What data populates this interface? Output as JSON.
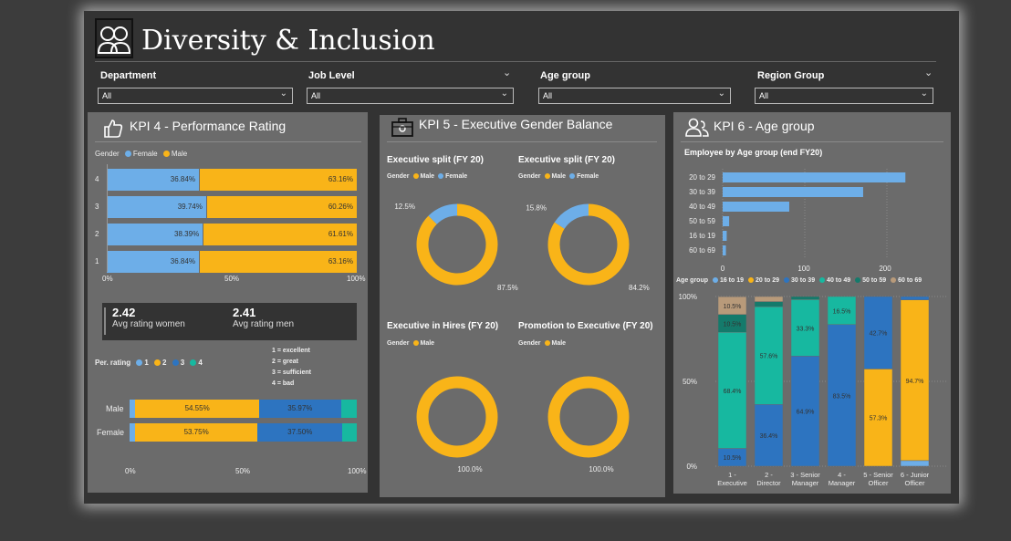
{
  "page": {
    "title": "Diversity & Inclusion"
  },
  "colors": {
    "female": "#6daee8",
    "male": "#f9b418",
    "rating1": "#6daee8",
    "rating2": "#f9b418",
    "rating3": "#2d74c0",
    "rating4": "#17b8a0",
    "age16_19": "#6daee8",
    "age20_29": "#f9b418",
    "age30_39": "#2d74c0",
    "age40_49": "#17b8a0",
    "age50_59": "#147a6b",
    "age60_69": "#b89a7a",
    "panel": "#6b6b6b"
  },
  "filters": [
    {
      "label": "Department",
      "value": "All"
    },
    {
      "label": "Job Level",
      "value": "All"
    },
    {
      "label": "Age group",
      "value": "All"
    },
    {
      "label": "Region Group",
      "value": "All"
    }
  ],
  "kpi4": {
    "title": "KPI 4 - Performance Rating",
    "legend_title": "Gender",
    "legend": [
      "Female",
      "Male"
    ],
    "rows": [
      {
        "cat": "4",
        "female": 36.84,
        "male": 63.16,
        "female_label": "36.84%",
        "male_label": "63.16%"
      },
      {
        "cat": "3",
        "female": 39.74,
        "male": 60.26,
        "female_label": "39.74%",
        "male_label": "60.26%"
      },
      {
        "cat": "2",
        "female": 38.39,
        "male": 61.61,
        "female_label": "38.39%",
        "male_label": "61.61%"
      },
      {
        "cat": "1",
        "female": 36.84,
        "male": 63.16,
        "female_label": "36.84%",
        "male_label": "63.16%"
      }
    ],
    "xticks": [
      "0%",
      "50%",
      "100%"
    ],
    "card": {
      "women_value": "2.42",
      "women_label": "Avg rating women",
      "men_value": "2.41",
      "men_label": "Avg rating men"
    },
    "rating_legend_title": "Per. rating",
    "rating_legend": [
      "1",
      "2",
      "3",
      "4"
    ],
    "rating_key": [
      "1 = excellent",
      "2 = great",
      "3 = sufficient",
      "4 = bad"
    ],
    "gender_rows": [
      {
        "cat": "Male",
        "r1": 2.5,
        "r2": 54.55,
        "r3": 35.97,
        "r4": 6.98,
        "r2_label": "54.55%",
        "r3_label": "35.97%"
      },
      {
        "cat": "Female",
        "r1": 2.5,
        "r2": 53.75,
        "r3": 37.5,
        "r4": 6.25,
        "r2_label": "53.75%",
        "r3_label": "37.50%"
      }
    ],
    "xticks2": [
      "0%",
      "50%",
      "100%"
    ]
  },
  "kpi5": {
    "title": "KPI 5 - Executive Gender Balance",
    "charts": [
      {
        "title": "Executive split (FY 20)",
        "legend_title": "Gender",
        "legend": [
          "Male",
          "Female"
        ],
        "legend_colors": [
          "#f9b418",
          "#6daee8"
        ],
        "slices": [
          {
            "name": "Male",
            "value": 87.5,
            "label": "87.5%",
            "color": "#f9b418"
          },
          {
            "name": "Female",
            "value": 12.5,
            "label": "12.5%",
            "color": "#6daee8"
          }
        ]
      },
      {
        "title": "Executive split (FY 20)",
        "legend_title": "Gender",
        "legend": [
          "Male",
          "Female"
        ],
        "legend_colors": [
          "#f9b418",
          "#6daee8"
        ],
        "slices": [
          {
            "name": "Male",
            "value": 84.2,
            "label": "84.2%",
            "color": "#f9b418"
          },
          {
            "name": "Female",
            "value": 15.8,
            "label": "15.8%",
            "color": "#6daee8"
          }
        ]
      },
      {
        "title": "Executive in Hires (FY 20)",
        "legend_title": "Gender",
        "legend": [
          "Male"
        ],
        "legend_colors": [
          "#f9b418"
        ],
        "slices": [
          {
            "name": "Male",
            "value": 100,
            "label": "100.0%",
            "color": "#f9b418"
          }
        ]
      },
      {
        "title": "Promotion to Executive (FY 20)",
        "legend_title": "Gender",
        "legend": [
          "Male"
        ],
        "legend_colors": [
          "#f9b418"
        ],
        "slices": [
          {
            "name": "Male",
            "value": 100,
            "label": "100.0%",
            "color": "#f9b418"
          }
        ]
      }
    ]
  },
  "kpi6": {
    "title": "KPI 6 - Age group",
    "bar_title": "Employee by Age group (end FY20)",
    "xticks": [
      "0",
      "100",
      "200"
    ],
    "legend_title": "Age group",
    "legend": [
      "16 to 19",
      "20 to 29",
      "30 to 39",
      "40 to 49",
      "50 to 59",
      "60 to 69"
    ],
    "stack_yticks": [
      "100%",
      "50%",
      "0%"
    ]
  },
  "chart_data": [
    {
      "type": "bar",
      "orientation": "horizontal",
      "title": "KPI 4 - Performance Rating",
      "categories": [
        "4",
        "3",
        "2",
        "1"
      ],
      "series": [
        {
          "name": "Female",
          "values": [
            36.84,
            39.74,
            38.39,
            36.84
          ]
        },
        {
          "name": "Male",
          "values": [
            63.16,
            60.26,
            61.61,
            63.16
          ]
        }
      ],
      "stacked": "100%",
      "xlim": [
        0,
        100
      ]
    },
    {
      "type": "bar",
      "orientation": "horizontal",
      "categories": [
        "Male",
        "Female"
      ],
      "series": [
        {
          "name": "1",
          "values": [
            2.5,
            2.5
          ]
        },
        {
          "name": "2",
          "values": [
            54.55,
            53.75
          ]
        },
        {
          "name": "3",
          "values": [
            35.97,
            37.5
          ]
        },
        {
          "name": "4",
          "values": [
            6.98,
            6.25
          ]
        }
      ],
      "stacked": "100%",
      "xlim": [
        0,
        100
      ]
    },
    {
      "type": "pie",
      "title": "Executive split (FY 20)",
      "categories": [
        "Male",
        "Female"
      ],
      "values": [
        87.5,
        12.5
      ]
    },
    {
      "type": "pie",
      "title": "Executive split (FY 20)",
      "categories": [
        "Male",
        "Female"
      ],
      "values": [
        84.2,
        15.8
      ]
    },
    {
      "type": "pie",
      "title": "Executive in Hires (FY 20)",
      "categories": [
        "Male"
      ],
      "values": [
        100.0
      ]
    },
    {
      "type": "pie",
      "title": "Promotion to Executive (FY 20)",
      "categories": [
        "Male"
      ],
      "values": [
        100.0
      ]
    },
    {
      "type": "bar",
      "orientation": "horizontal",
      "title": "Employee by Age group (end FY20)",
      "categories": [
        "20 to 29",
        "30 to 39",
        "40 to 49",
        "50 to 59",
        "16 to 19",
        "60 to 69"
      ],
      "values": [
        225,
        173,
        82,
        8,
        5,
        4
      ],
      "xlim": [
        0,
        250
      ]
    },
    {
      "type": "bar",
      "stacked": "100%",
      "categories": [
        "1 - Executive",
        "2 - Director",
        "3 - Senior Manager",
        "4 - Manager",
        "5 - Senior Officer",
        "6 - Junior Officer"
      ],
      "series": [
        {
          "name": "16 to 19",
          "values": [
            0,
            0,
            0,
            0,
            0,
            3.3
          ]
        },
        {
          "name": "20 to 29",
          "values": [
            0,
            0,
            0,
            0,
            57.3,
            94.7
          ]
        },
        {
          "name": "30 to 39",
          "values": [
            10.5,
            36.4,
            64.9,
            83.5,
            42.7,
            2.0
          ]
        },
        {
          "name": "40 to 49",
          "values": [
            68.4,
            57.6,
            33.3,
            16.5,
            0,
            0
          ]
        },
        {
          "name": "50 to 59",
          "values": [
            10.5,
            3.0,
            1.8,
            0,
            0,
            0
          ]
        },
        {
          "name": "60 to 69",
          "values": [
            10.5,
            3.0,
            0,
            0,
            0,
            0
          ]
        }
      ],
      "labels": [
        {
          "cat": 0,
          "series": "30 to 39",
          "label": "10.5%"
        },
        {
          "cat": 0,
          "series": "40 to 49",
          "label": "68.4%"
        },
        {
          "cat": 0,
          "series": "50 to 59",
          "label": "10.5%"
        },
        {
          "cat": 0,
          "series": "60 to 69",
          "label": "10.5%"
        },
        {
          "cat": 1,
          "series": "30 to 39",
          "label": "36.4%"
        },
        {
          "cat": 1,
          "series": "40 to 49",
          "label": "57.6%"
        },
        {
          "cat": 2,
          "series": "30 to 39",
          "label": "64.9%"
        },
        {
          "cat": 2,
          "series": "40 to 49",
          "label": "33.3%"
        },
        {
          "cat": 3,
          "series": "30 to 39",
          "label": "83.5%"
        },
        {
          "cat": 3,
          "series": "40 to 49",
          "label": "16.5%"
        },
        {
          "cat": 4,
          "series": "20 to 29",
          "label": "57.3%"
        },
        {
          "cat": 4,
          "series": "30 to 39",
          "label": "42.7%"
        },
        {
          "cat": 5,
          "series": "20 to 29",
          "label": "94.7%"
        }
      ],
      "ylim": [
        0,
        100
      ]
    }
  ]
}
